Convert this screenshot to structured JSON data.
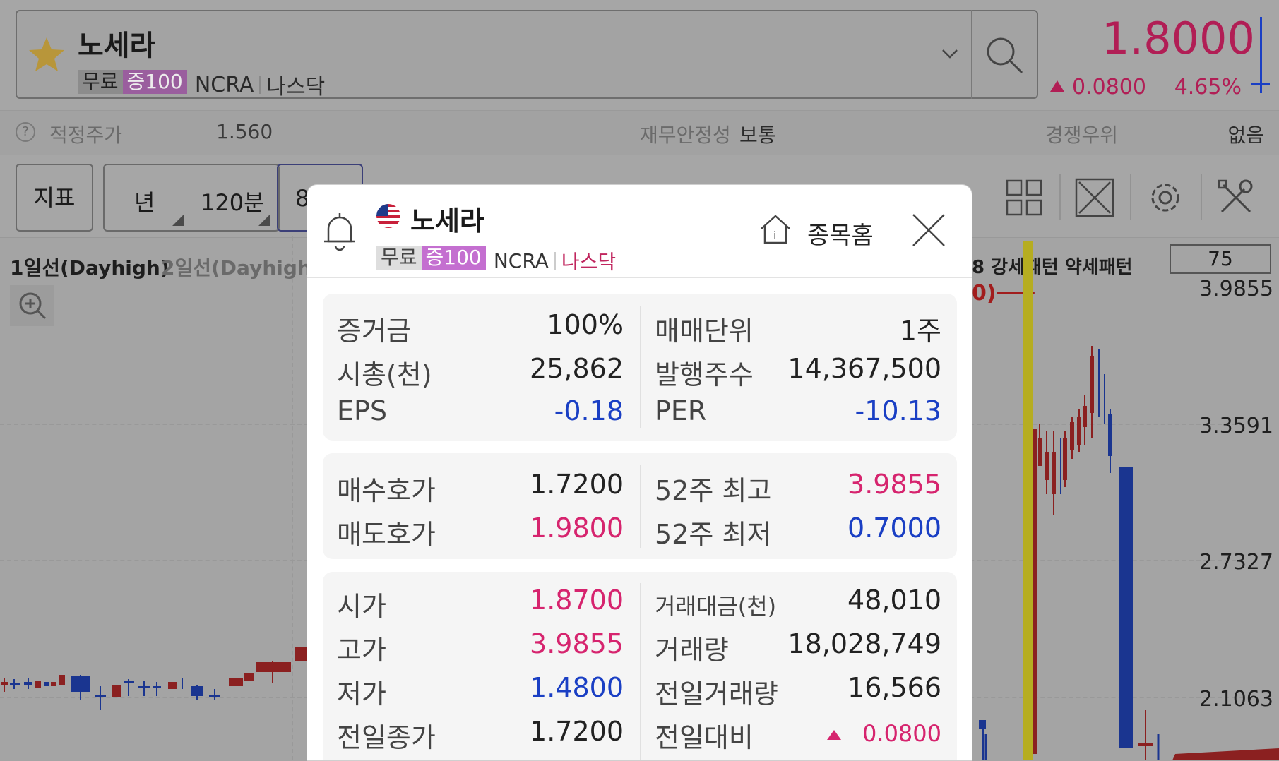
{
  "header": {
    "stock_name": "노세라",
    "tag_free": "무료",
    "tag_margin": "증100",
    "ticker": "NCRA",
    "exchange": "나스닥",
    "price": "1.8000",
    "change": "0.0800",
    "change_pct": "4.65%",
    "colors": {
      "up": "#c01e5c",
      "down": "#1a3fc4",
      "favorite": "#caa53a"
    }
  },
  "info_bar": {
    "fair_price_label": "적정주가",
    "fair_price_value": "1.560",
    "stability_label": "재무안정성",
    "stability_value": "보통",
    "competitive_label": "경쟁우위",
    "competitive_value": "없음"
  },
  "toolbar": {
    "indicator": "지표",
    "period_year": "년",
    "period_120": "120분",
    "period_partial": "8"
  },
  "chart": {
    "legend_1": "1일선(Dayhigh)",
    "legend_2": "2일선(Dayhigh)",
    "pattern_partial": "8 강세패턴 약세패턴",
    "arrow_label_partial": "0)",
    "box_value": "75",
    "price_labels": [
      "3.9855",
      "3.3591",
      "2.7327",
      "2.1063"
    ]
  },
  "popup": {
    "name": "노세라",
    "tag_free": "무료",
    "tag_margin": "증100",
    "ticker": "NCRA",
    "exchange": "나스닥",
    "home_label": "종목홈",
    "card1": {
      "margin_label": "증거금",
      "margin_value": "100%",
      "unit_label": "매매단위",
      "unit_value": "1주",
      "mcap_label": "시총(천)",
      "mcap_value": "25,862",
      "shares_label": "발행주수",
      "shares_value": "14,367,500",
      "eps_label": "EPS",
      "eps_value": "-0.18",
      "per_label": "PER",
      "per_value": "-10.13"
    },
    "card2": {
      "bid_label": "매수호가",
      "bid_value": "1.7200",
      "high52_label": "52주 최고",
      "high52_value": "3.9855",
      "ask_label": "매도호가",
      "ask_value": "1.9800",
      "low52_label": "52주 최저",
      "low52_value": "0.7000"
    },
    "card3": {
      "open_label": "시가",
      "open_value": "1.8700",
      "amount_label": "거래대금(천)",
      "amount_value": "48,010",
      "high_label": "고가",
      "high_value": "3.9855",
      "volume_label": "거래량",
      "volume_value": "18,028,749",
      "low_label": "저가",
      "low_value": "1.4800",
      "prev_volume_label": "전일거래량",
      "prev_volume_value": "16,566",
      "prev_close_label": "전일종가",
      "prev_close_value": "1.7200",
      "prev_change_label": "전일대비",
      "prev_change_value": "0.0800"
    }
  }
}
